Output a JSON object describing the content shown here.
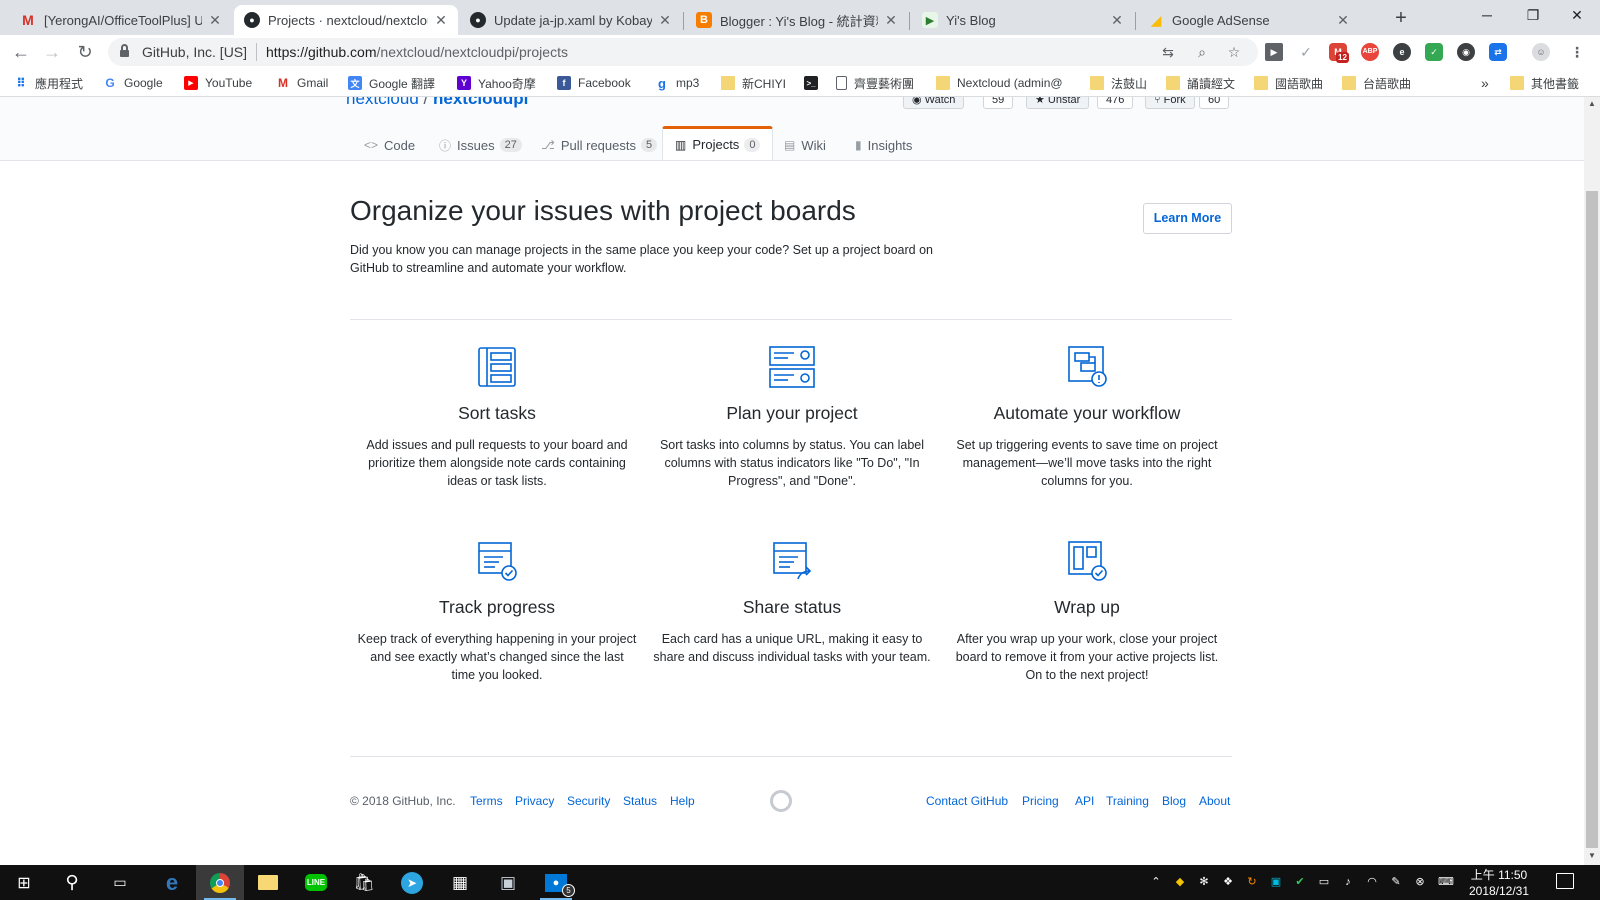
{
  "browser": {
    "tabs": [
      {
        "title": "[YerongAI/OfficeToolPlus] Up",
        "icon": "gmail-icon",
        "active": false
      },
      {
        "title": "Projects · nextcloud/nextclou",
        "icon": "github-icon",
        "active": true
      },
      {
        "title": "Update ja-jp.xaml by Kobays",
        "icon": "github-icon",
        "active": false
      },
      {
        "title": "Blogger : Yi's Blog - 統計資料",
        "icon": "blogger-icon",
        "active": false
      },
      {
        "title": "Yi's Blog",
        "icon": "blog-icon",
        "active": false
      },
      {
        "title": "Google AdSense",
        "icon": "adsense-icon",
        "active": false
      }
    ],
    "address": {
      "org": "GitHub, Inc. [US]",
      "url_host": "https://github.com",
      "url_path": "/nextcloud/nextcloudpi/projects"
    },
    "gmail_badge": "12",
    "bookmarks": [
      {
        "label": "應用程式",
        "icon": "apps-grid-icon"
      },
      {
        "label": "Google",
        "icon": "google-icon"
      },
      {
        "label": "YouTube",
        "icon": "youtube-icon"
      },
      {
        "label": "Gmail",
        "icon": "gmail-icon"
      },
      {
        "label": "Google 翻譯",
        "icon": "translate-icon"
      },
      {
        "label": "Yahoo奇摩",
        "icon": "yahoo-icon"
      },
      {
        "label": "Facebook",
        "icon": "facebook-icon"
      },
      {
        "label": "mp3",
        "icon": "mp3-icon"
      },
      {
        "label": "新CHIYI",
        "icon": "folder-icon"
      },
      {
        "label": "",
        "icon": "terminal-icon"
      },
      {
        "label": "齊豐藝術團",
        "icon": "page-icon"
      },
      {
        "label": "Nextcloud (admin@",
        "icon": "folder-icon"
      },
      {
        "label": "法鼓山",
        "icon": "folder-icon"
      },
      {
        "label": "誦讀經文",
        "icon": "folder-icon"
      },
      {
        "label": "國語歌曲",
        "icon": "folder-icon"
      },
      {
        "label": "台語歌曲",
        "icon": "folder-icon"
      }
    ],
    "more_bookmarks": "»",
    "other_bookmarks": "其他書籤"
  },
  "repo": {
    "owner": "nextcloud",
    "slash": "/",
    "name": "nextcloudpi",
    "watch_label": "Watch",
    "watch_count": "59",
    "star_label": "Unstar",
    "star_count": "476",
    "fork_label": "Fork",
    "fork_count": "60",
    "nav": [
      {
        "label": "Code",
        "count": "",
        "selected": false
      },
      {
        "label": "Issues",
        "count": "27",
        "selected": false
      },
      {
        "label": "Pull requests",
        "count": "5",
        "selected": false
      },
      {
        "label": "Projects",
        "count": "0",
        "selected": true
      },
      {
        "label": "Wiki",
        "count": "",
        "selected": false
      },
      {
        "label": "Insights",
        "count": "",
        "selected": false
      }
    ]
  },
  "main": {
    "title": "Organize your issues with project boards",
    "lead": "Did you know you can manage projects in the same place you keep your code? Set up a project board on GitHub to streamline and automate your workflow.",
    "learn_more": "Learn More",
    "features": [
      {
        "title": "Sort tasks",
        "text": "Add issues and pull requests to your board and prioritize them alongside note cards containing ideas or task lists.",
        "icon": "sort-tasks-icon"
      },
      {
        "title": "Plan your project",
        "text": "Sort tasks into columns by status. You can label columns with status indicators like \"To Do\", \"In Progress\", and \"Done\".",
        "icon": "plan-project-icon"
      },
      {
        "title": "Automate your workflow",
        "text": "Set up triggering events to save time on project management—we’ll move tasks into the right columns for you.",
        "icon": "automate-workflow-icon"
      },
      {
        "title": "Track progress",
        "text": "Keep track of everything happening in your project and see exactly what’s changed since the last time you looked.",
        "icon": "track-progress-icon"
      },
      {
        "title": "Share status",
        "text": "Each card has a unique URL, making it easy to share and discuss individual tasks with your team.",
        "icon": "share-status-icon"
      },
      {
        "title": "Wrap up",
        "text": "After you wrap up your work, close your project board to remove it from your active projects list. On to the next project!",
        "icon": "wrap-up-icon"
      }
    ]
  },
  "footer": {
    "copyright": "© 2018 GitHub, Inc.",
    "left_links": [
      "Terms",
      "Privacy",
      "Security",
      "Status",
      "Help"
    ],
    "right_links": [
      "Contact GitHub",
      "Pricing",
      "API",
      "Training",
      "Blog",
      "About"
    ]
  },
  "taskbar": {
    "clock_time": "上午 11:50",
    "clock_date": "2018/12/31",
    "messenger_badge": "5"
  },
  "colors": {
    "link": "#0366d6",
    "selected_tab_accent": "#e36209",
    "icon_blue": "#0366d6",
    "taskbar": "#101010"
  }
}
